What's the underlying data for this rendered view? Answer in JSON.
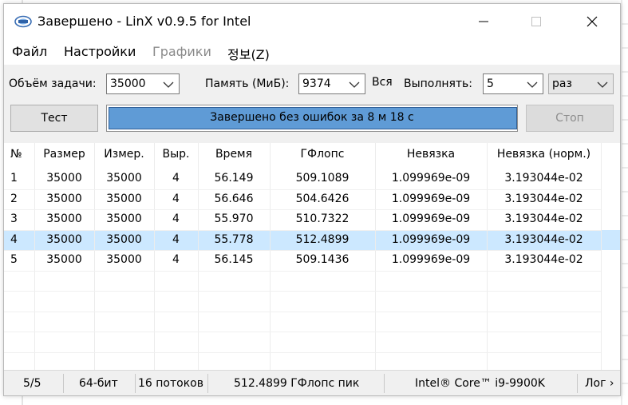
{
  "window": {
    "title": "Завершено - LinX v0.9.5 for Intel",
    "min_glyph": "—",
    "max_glyph": "☐",
    "close_glyph": "✕",
    "app_icon": "linx-app-icon"
  },
  "menu": {
    "items": [
      {
        "label": "Файл",
        "enabled": true
      },
      {
        "label": "Настройки",
        "enabled": true
      },
      {
        "label": "Графики",
        "enabled": false
      },
      {
        "label": "정보(Z)",
        "enabled": true
      }
    ]
  },
  "controls": {
    "problem_size_label": "Объём задачи:",
    "problem_size_value": "35000",
    "memory_label": "Память (МиБ):",
    "memory_value": "9374",
    "all_label": "Вся",
    "run_label": "Выполнять:",
    "runs_value": "5",
    "runs_unit": "раз"
  },
  "actions": {
    "test_label": "Тест",
    "stop_label": "Стоп"
  },
  "progress": {
    "text": "Завершено без ошибок за 8 м 18 с",
    "fraction": 1.0,
    "fill_color": "#5f9bd6"
  },
  "table": {
    "columns": [
      "№",
      "Размер",
      "Измер.",
      "Выр.",
      "Время",
      "ГФлопс",
      "Невязка",
      "Невязка (норм.)"
    ],
    "rows": [
      [
        "1",
        "35000",
        "35000",
        "4",
        "56.149",
        "509.1089",
        "1.099969e-09",
        "3.193044e-02"
      ],
      [
        "2",
        "35000",
        "35000",
        "4",
        "56.646",
        "504.6426",
        "1.099969e-09",
        "3.193044e-02"
      ],
      [
        "3",
        "35000",
        "35000",
        "4",
        "55.970",
        "510.7322",
        "1.099969e-09",
        "3.193044e-02"
      ],
      [
        "4",
        "35000",
        "35000",
        "4",
        "55.778",
        "512.4899",
        "1.099969e-09",
        "3.193044e-02"
      ],
      [
        "5",
        "35000",
        "35000",
        "4",
        "56.145",
        "509.1436",
        "1.099969e-09",
        "3.193044e-02"
      ]
    ],
    "selected_row": 4,
    "selected_color": "#cce8ff"
  },
  "status": {
    "progress": "5/5",
    "bits": "64-бит",
    "threads": "16 потоков",
    "peak": "512.4899 ГФлопс пик",
    "cpu": "Intel® Core™ i9-9900K",
    "log": "Лог ›"
  }
}
